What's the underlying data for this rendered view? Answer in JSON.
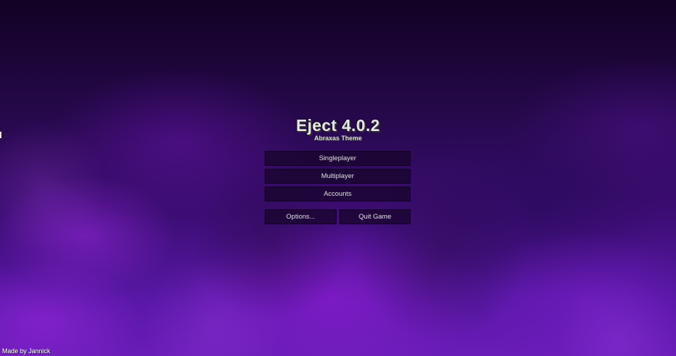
{
  "title": "Eject 4.0.2",
  "subtitle": "Abraxas Theme",
  "menu": {
    "singleplayer": "Singleplayer",
    "multiplayer": "Multiplayer",
    "accounts": "Accounts",
    "options": "Options...",
    "quit": "Quit Game"
  },
  "footer": {
    "credit": "Made by Jannick"
  },
  "colors": {
    "background_top": "#120224",
    "background_bottom": "#6a1cb8",
    "button_fill": "#160428",
    "button_text": "#e0e0e0",
    "title_text": "#e6e6e6"
  }
}
